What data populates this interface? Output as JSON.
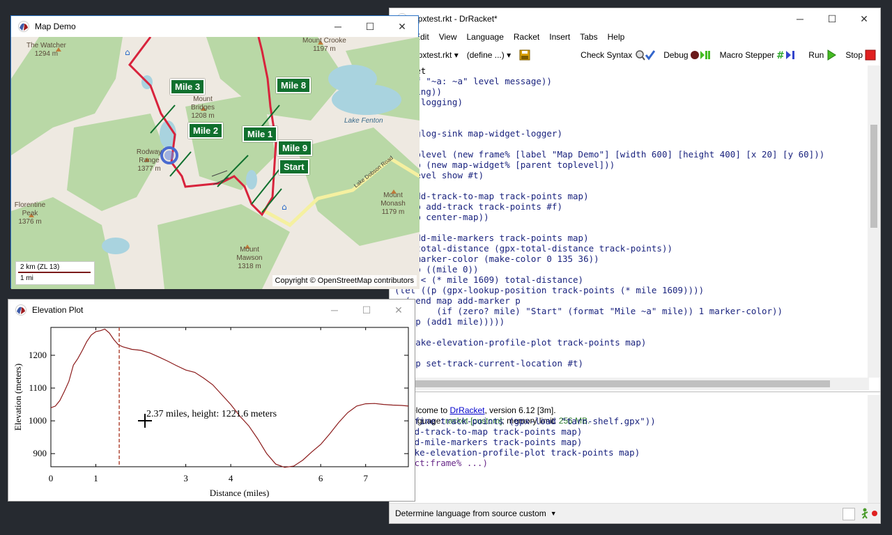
{
  "drracket": {
    "title": "gpxtest.rkt - DrRacket*",
    "menus": [
      "Edit",
      "View",
      "Language",
      "Racket",
      "Insert",
      "Tabs",
      "Help"
    ],
    "toolbar": {
      "file_dropdown": "gpxtest.rkt ▾",
      "define_dropdown": "(define ...) ▾",
      "check_syntax": "Check Syntax",
      "debug": "Debug",
      "macro_stepper": "Macro Stepper",
      "run": "Run",
      "stop": "Stop"
    },
    "code_lines": [
      "#lang racket",
      "    (printf \"~a: ~a\" level message))",
      "  (do-logging))",
      "(thread do-logging)",
      "(void))",
      "",
      "(define-dbglog-sink map-widget-logger)",
      "",
      "(define toplevel (new frame% [label \"Map Demo\"] [width 600] [height 400] [x 20] [y 60]))",
      "(define map (new map-widget% [parent toplevel]))",
      "(send toplevel show #t)",
      "",
      "(define (add-track-to-map track-points map)",
      "  (send map add-track track-points #f)",
      "  (send map center-map))",
      "",
      "(define (add-mile-markers track-points map)",
      "  (define total-distance (gpx-total-distance track-points))",
      "  (define marker-color (make-color 0 135 36))",
      "  (let loop ((mile 0))",
      "    (when (< (* mile 1609) total-distance)",
      "      (let ((p (gpx-lookup-position track-points (* mile 1609))))",
      "        (send map add-marker p",
      "              (if (zero? mile) \"Start\" (format \"Mile ~a\" mile)) 1 marker-color))",
      "      (loop (add1 mile)))))",
      "",
      "(define (make-elevation-profile-plot track-points map)",
      "",
      "  (send map set-track-current-location #t)"
    ],
    "interactions": {
      "welcome_prefix": "Welcome to ",
      "welcome_link": "DrRacket",
      "welcome_suffix": ", version 6.12 [3m].",
      "language_prefix": "Language: ",
      "language_value": "racket [custom]",
      "language_mid": "; memory limit: ",
      "memory_value": "256 MB.",
      "lines": [
        "> (define track-points (gpx-load \"tarn-shelf.gpx\"))",
        "> (add-track-to-map track-points map)",
        "> (add-mile-markers track-points map)",
        "> (make-elevation-profile-plot track-points map)",
        "(object:frame% ...)"
      ]
    },
    "status": "Determine language from source custom"
  },
  "mapdemo": {
    "title": "Map Demo",
    "labels": {
      "watcher": "The Watcher",
      "watcher_h": "1294 m",
      "crooke": "Mount Crooke",
      "crooke_h": "1197 m",
      "bridges": "Mount Bridges",
      "bridges_h": "1208 m",
      "rodway": "Rodway Range",
      "rodway_h": "1377 m",
      "florentine": "Florentine Peak",
      "florentine_h": "1376 m",
      "mawson": "Mount Mawson",
      "mawson_h": "1318 m",
      "monash": "Mount Monash",
      "monash_h": "1179 m",
      "fenton": "Lake Fenton",
      "dobson": "Lake Dobson Road"
    },
    "markers": [
      "Mile 3",
      "Mile 8",
      "Mile 2",
      "Mile 1",
      "Mile 9",
      "Start"
    ],
    "scale_km": "2 km  (ZL 13)",
    "scale_mi": "1 mi",
    "copyright": "Copyright © OpenStreetMap contributors"
  },
  "elevation": {
    "title": "Elevation Plot",
    "tooltip": "2.37 miles, height: 1221.6 meters"
  },
  "chart_data": {
    "type": "line",
    "xlabel": "Distance (miles)",
    "ylabel": "Elevation (meters)",
    "xlim": [
      0,
      7.95
    ],
    "ylim": [
      860,
      1285
    ],
    "x_ticks": [
      0,
      1,
      3,
      4,
      6,
      7
    ],
    "y_ticks": [
      900,
      1000,
      1100,
      1200
    ],
    "marker_x": 1.52,
    "series": [
      {
        "x": [
          0,
          0.1,
          0.2,
          0.3,
          0.4,
          0.5,
          0.6,
          0.7,
          0.8,
          0.9,
          1.0,
          1.1,
          1.2,
          1.3,
          1.4,
          1.5,
          1.6,
          1.8,
          2.0,
          2.2,
          2.4,
          2.6,
          2.8,
          3.0,
          3.2,
          3.4,
          3.6,
          3.8,
          4.0,
          4.2,
          4.4,
          4.6,
          4.8,
          5.0,
          5.2,
          5.4,
          5.6,
          5.8,
          6.0,
          6.2,
          6.4,
          6.6,
          6.8,
          7.0,
          7.2,
          7.4,
          7.6,
          7.8,
          7.95
        ],
        "y": [
          1040,
          1045,
          1062,
          1090,
          1120,
          1170,
          1190,
          1215,
          1242,
          1262,
          1272,
          1275,
          1280,
          1268,
          1248,
          1232,
          1226,
          1218,
          1215,
          1207,
          1195,
          1182,
          1168,
          1155,
          1148,
          1130,
          1110,
          1080,
          1050,
          1015,
          985,
          945,
          900,
          868,
          858,
          862,
          880,
          905,
          928,
          960,
          995,
          1025,
          1045,
          1052,
          1053,
          1050,
          1048,
          1047,
          1045
        ]
      }
    ]
  }
}
